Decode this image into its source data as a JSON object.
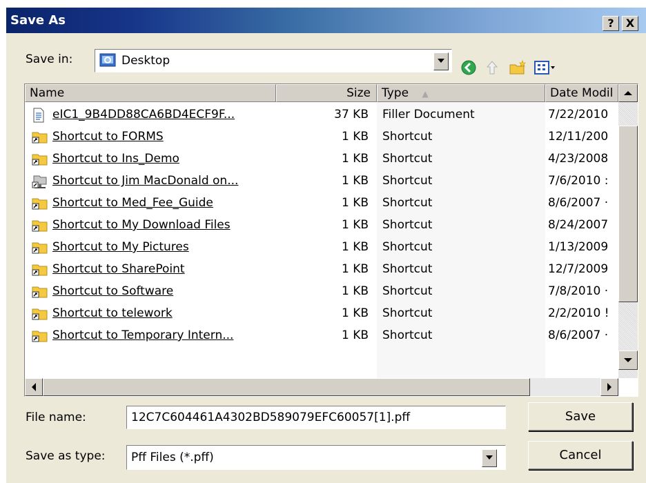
{
  "window": {
    "title": "Save As",
    "help_btn": "?",
    "close_btn": "X"
  },
  "toolbar": {
    "save_in_label": "Save in:",
    "location": "Desktop",
    "icons": [
      "back-icon",
      "up-folder-icon",
      "new-folder-icon",
      "views-menu-icon"
    ]
  },
  "columns": {
    "name": "Name",
    "size": "Size",
    "type": "Type",
    "date": "Date Modil",
    "sort_arrow": "▲"
  },
  "files": [
    {
      "name": "eIC1_9B4DD88CA6BD4ECF9F...",
      "size": "37 KB",
      "type": "Filler Document",
      "date": "7/22/2010",
      "icon": "document-icon"
    },
    {
      "name": "Shortcut to FORMS",
      "size": "1 KB",
      "type": "Shortcut",
      "date": "12/11/200",
      "icon": "folder-shortcut-icon"
    },
    {
      "name": "Shortcut to Ins_Demo",
      "size": "1 KB",
      "type": "Shortcut",
      "date": "4/23/2008",
      "icon": "folder-shortcut-icon"
    },
    {
      "name": "Shortcut to Jim MacDonald on...",
      "size": "1 KB",
      "type": "Shortcut",
      "date": "7/6/2010 :",
      "icon": "network-share-icon"
    },
    {
      "name": "Shortcut to Med_Fee_Guide",
      "size": "1 KB",
      "type": "Shortcut",
      "date": "8/6/2007 ·",
      "icon": "folder-shortcut-icon"
    },
    {
      "name": "Shortcut to My Download Files",
      "size": "1 KB",
      "type": "Shortcut",
      "date": "8/24/2007",
      "icon": "folder-shortcut-icon"
    },
    {
      "name": "Shortcut to My Pictures",
      "size": "1 KB",
      "type": "Shortcut",
      "date": "1/13/2009",
      "icon": "folder-shortcut-icon"
    },
    {
      "name": "Shortcut to SharePoint",
      "size": "1 KB",
      "type": "Shortcut",
      "date": "12/7/2009",
      "icon": "folder-shortcut-icon"
    },
    {
      "name": "Shortcut to Software",
      "size": "1 KB",
      "type": "Shortcut",
      "date": "7/8/2010 ·",
      "icon": "folder-shortcut-icon"
    },
    {
      "name": "Shortcut to telework",
      "size": "1 KB",
      "type": "Shortcut",
      "date": "2/2/2010 !",
      "icon": "folder-shortcut-icon"
    },
    {
      "name": "Shortcut to Temporary Intern...",
      "size": "1 KB",
      "type": "Shortcut",
      "date": "8/6/2007 ·",
      "icon": "folder-shortcut-icon"
    }
  ],
  "form": {
    "filename_label": "File name:",
    "filename_value": "12C7C604461A4302BD589079EFC60057[1].pff",
    "type_label": "Save as type:",
    "type_value": "Pff Files (*.pff)"
  },
  "buttons": {
    "save": "Save",
    "cancel": "Cancel"
  }
}
